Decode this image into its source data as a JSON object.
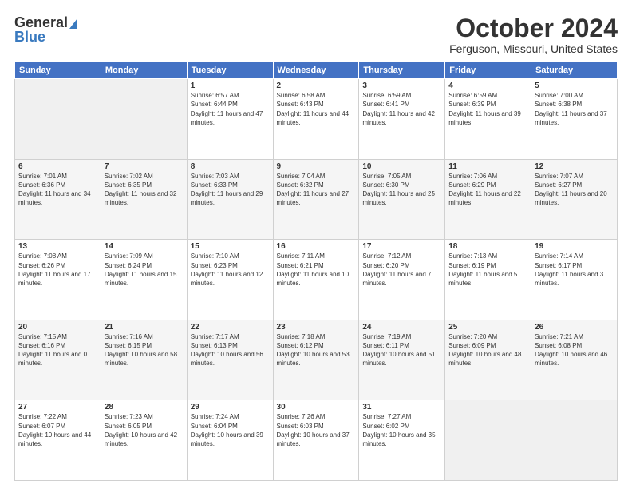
{
  "logo": {
    "line1": "General",
    "line2": "Blue"
  },
  "title": "October 2024",
  "subtitle": "Ferguson, Missouri, United States",
  "days_of_week": [
    "Sunday",
    "Monday",
    "Tuesday",
    "Wednesday",
    "Thursday",
    "Friday",
    "Saturday"
  ],
  "weeks": [
    [
      {
        "day": "",
        "sunrise": "",
        "sunset": "",
        "daylight": "",
        "empty": true
      },
      {
        "day": "",
        "sunrise": "",
        "sunset": "",
        "daylight": "",
        "empty": true
      },
      {
        "day": "1",
        "sunrise": "Sunrise: 6:57 AM",
        "sunset": "Sunset: 6:44 PM",
        "daylight": "Daylight: 11 hours and 47 minutes."
      },
      {
        "day": "2",
        "sunrise": "Sunrise: 6:58 AM",
        "sunset": "Sunset: 6:43 PM",
        "daylight": "Daylight: 11 hours and 44 minutes."
      },
      {
        "day": "3",
        "sunrise": "Sunrise: 6:59 AM",
        "sunset": "Sunset: 6:41 PM",
        "daylight": "Daylight: 11 hours and 42 minutes."
      },
      {
        "day": "4",
        "sunrise": "Sunrise: 6:59 AM",
        "sunset": "Sunset: 6:39 PM",
        "daylight": "Daylight: 11 hours and 39 minutes."
      },
      {
        "day": "5",
        "sunrise": "Sunrise: 7:00 AM",
        "sunset": "Sunset: 6:38 PM",
        "daylight": "Daylight: 11 hours and 37 minutes."
      }
    ],
    [
      {
        "day": "6",
        "sunrise": "Sunrise: 7:01 AM",
        "sunset": "Sunset: 6:36 PM",
        "daylight": "Daylight: 11 hours and 34 minutes."
      },
      {
        "day": "7",
        "sunrise": "Sunrise: 7:02 AM",
        "sunset": "Sunset: 6:35 PM",
        "daylight": "Daylight: 11 hours and 32 minutes."
      },
      {
        "day": "8",
        "sunrise": "Sunrise: 7:03 AM",
        "sunset": "Sunset: 6:33 PM",
        "daylight": "Daylight: 11 hours and 29 minutes."
      },
      {
        "day": "9",
        "sunrise": "Sunrise: 7:04 AM",
        "sunset": "Sunset: 6:32 PM",
        "daylight": "Daylight: 11 hours and 27 minutes."
      },
      {
        "day": "10",
        "sunrise": "Sunrise: 7:05 AM",
        "sunset": "Sunset: 6:30 PM",
        "daylight": "Daylight: 11 hours and 25 minutes."
      },
      {
        "day": "11",
        "sunrise": "Sunrise: 7:06 AM",
        "sunset": "Sunset: 6:29 PM",
        "daylight": "Daylight: 11 hours and 22 minutes."
      },
      {
        "day": "12",
        "sunrise": "Sunrise: 7:07 AM",
        "sunset": "Sunset: 6:27 PM",
        "daylight": "Daylight: 11 hours and 20 minutes."
      }
    ],
    [
      {
        "day": "13",
        "sunrise": "Sunrise: 7:08 AM",
        "sunset": "Sunset: 6:26 PM",
        "daylight": "Daylight: 11 hours and 17 minutes."
      },
      {
        "day": "14",
        "sunrise": "Sunrise: 7:09 AM",
        "sunset": "Sunset: 6:24 PM",
        "daylight": "Daylight: 11 hours and 15 minutes."
      },
      {
        "day": "15",
        "sunrise": "Sunrise: 7:10 AM",
        "sunset": "Sunset: 6:23 PM",
        "daylight": "Daylight: 11 hours and 12 minutes."
      },
      {
        "day": "16",
        "sunrise": "Sunrise: 7:11 AM",
        "sunset": "Sunset: 6:21 PM",
        "daylight": "Daylight: 11 hours and 10 minutes."
      },
      {
        "day": "17",
        "sunrise": "Sunrise: 7:12 AM",
        "sunset": "Sunset: 6:20 PM",
        "daylight": "Daylight: 11 hours and 7 minutes."
      },
      {
        "day": "18",
        "sunrise": "Sunrise: 7:13 AM",
        "sunset": "Sunset: 6:19 PM",
        "daylight": "Daylight: 11 hours and 5 minutes."
      },
      {
        "day": "19",
        "sunrise": "Sunrise: 7:14 AM",
        "sunset": "Sunset: 6:17 PM",
        "daylight": "Daylight: 11 hours and 3 minutes."
      }
    ],
    [
      {
        "day": "20",
        "sunrise": "Sunrise: 7:15 AM",
        "sunset": "Sunset: 6:16 PM",
        "daylight": "Daylight: 11 hours and 0 minutes."
      },
      {
        "day": "21",
        "sunrise": "Sunrise: 7:16 AM",
        "sunset": "Sunset: 6:15 PM",
        "daylight": "Daylight: 10 hours and 58 minutes."
      },
      {
        "day": "22",
        "sunrise": "Sunrise: 7:17 AM",
        "sunset": "Sunset: 6:13 PM",
        "daylight": "Daylight: 10 hours and 56 minutes."
      },
      {
        "day": "23",
        "sunrise": "Sunrise: 7:18 AM",
        "sunset": "Sunset: 6:12 PM",
        "daylight": "Daylight: 10 hours and 53 minutes."
      },
      {
        "day": "24",
        "sunrise": "Sunrise: 7:19 AM",
        "sunset": "Sunset: 6:11 PM",
        "daylight": "Daylight: 10 hours and 51 minutes."
      },
      {
        "day": "25",
        "sunrise": "Sunrise: 7:20 AM",
        "sunset": "Sunset: 6:09 PM",
        "daylight": "Daylight: 10 hours and 48 minutes."
      },
      {
        "day": "26",
        "sunrise": "Sunrise: 7:21 AM",
        "sunset": "Sunset: 6:08 PM",
        "daylight": "Daylight: 10 hours and 46 minutes."
      }
    ],
    [
      {
        "day": "27",
        "sunrise": "Sunrise: 7:22 AM",
        "sunset": "Sunset: 6:07 PM",
        "daylight": "Daylight: 10 hours and 44 minutes."
      },
      {
        "day": "28",
        "sunrise": "Sunrise: 7:23 AM",
        "sunset": "Sunset: 6:05 PM",
        "daylight": "Daylight: 10 hours and 42 minutes."
      },
      {
        "day": "29",
        "sunrise": "Sunrise: 7:24 AM",
        "sunset": "Sunset: 6:04 PM",
        "daylight": "Daylight: 10 hours and 39 minutes."
      },
      {
        "day": "30",
        "sunrise": "Sunrise: 7:26 AM",
        "sunset": "Sunset: 6:03 PM",
        "daylight": "Daylight: 10 hours and 37 minutes."
      },
      {
        "day": "31",
        "sunrise": "Sunrise: 7:27 AM",
        "sunset": "Sunset: 6:02 PM",
        "daylight": "Daylight: 10 hours and 35 minutes."
      },
      {
        "day": "",
        "sunrise": "",
        "sunset": "",
        "daylight": "",
        "empty": true
      },
      {
        "day": "",
        "sunrise": "",
        "sunset": "",
        "daylight": "",
        "empty": true
      }
    ]
  ]
}
